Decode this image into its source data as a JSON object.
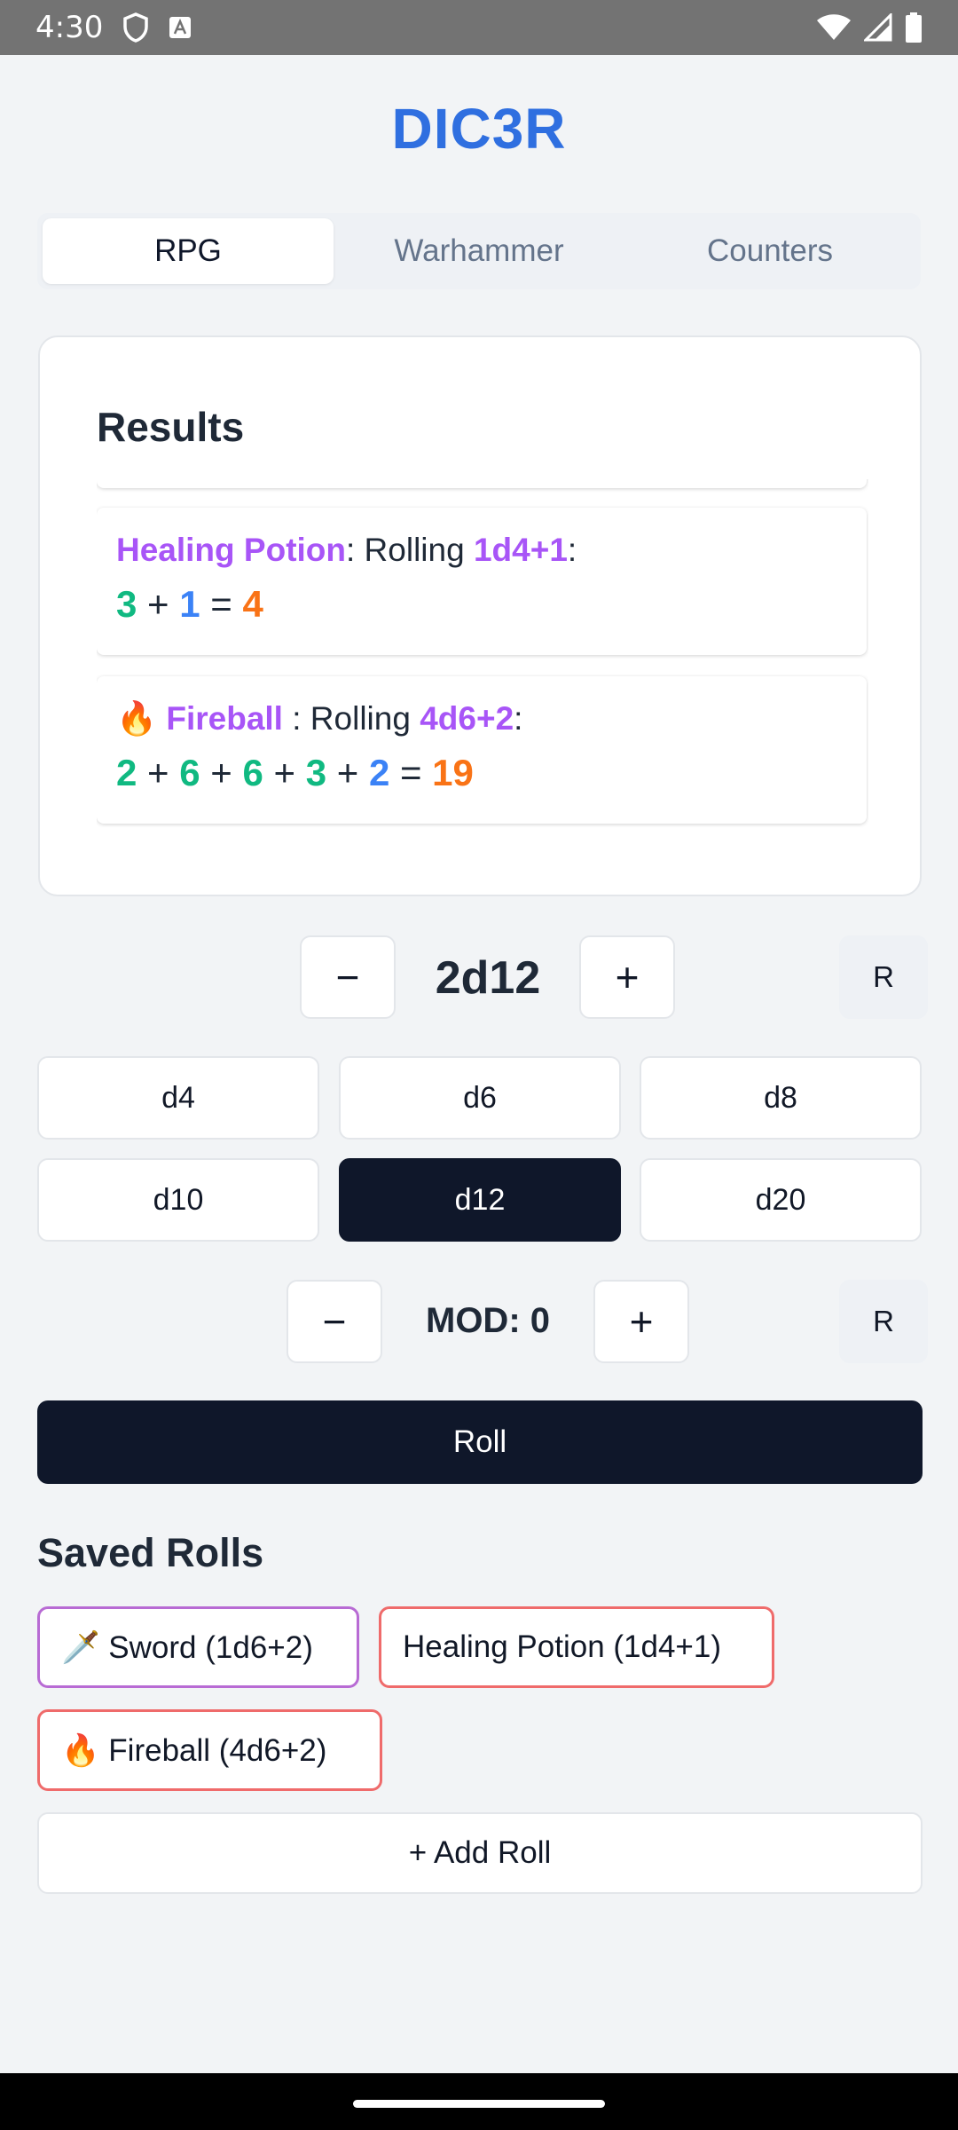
{
  "status_bar": {
    "time": "4:30"
  },
  "app": {
    "title": "DIC3R"
  },
  "tabs": [
    {
      "label": "RPG",
      "active": true
    },
    {
      "label": "Warhammer",
      "active": false
    },
    {
      "label": "Counters",
      "active": false
    }
  ],
  "results": {
    "title": "Results",
    "items": [
      {
        "icon": "",
        "name": "Healing Potion",
        "rolling_text": ": Rolling ",
        "formula": "1d4+1",
        "colon": ":",
        "rolls": [
          "3"
        ],
        "modifier": "1",
        "total": "4"
      },
      {
        "icon": "🔥",
        "name": "Fireball",
        "rolling_text": " : Rolling ",
        "formula": "4d6+2",
        "colon": ":",
        "rolls": [
          "2",
          "6",
          "6",
          "3"
        ],
        "modifier": "2",
        "total": "19"
      }
    ]
  },
  "dice_selector": {
    "minus": "−",
    "plus": "+",
    "value": "2d12",
    "reset": "R"
  },
  "dice": [
    {
      "label": "d4",
      "selected": false
    },
    {
      "label": "d6",
      "selected": false
    },
    {
      "label": "d8",
      "selected": false
    },
    {
      "label": "d10",
      "selected": false
    },
    {
      "label": "d12",
      "selected": true
    },
    {
      "label": "d20",
      "selected": false
    }
  ],
  "modifier": {
    "minus": "−",
    "plus": "+",
    "value": "MOD: 0",
    "reset": "R"
  },
  "roll_button": "Roll",
  "saved": {
    "title": "Saved Rolls",
    "items": [
      {
        "label": "🗡️ Sword (1d6+2)",
        "border_color": "#b86bd4"
      },
      {
        "label": "Healing Potion (1d4+1)",
        "border_color": "#ef6b6b"
      },
      {
        "label": "🔥 Fireball (4d6+2)",
        "border_color": "#ef6b6b"
      }
    ],
    "add_label": "+ Add Roll"
  },
  "colors": {
    "accent": "#2f6fe0",
    "dark": "#0f172a",
    "purple": "#a855f7",
    "green": "#10b981",
    "blue": "#3b82f6",
    "orange": "#f97316"
  }
}
